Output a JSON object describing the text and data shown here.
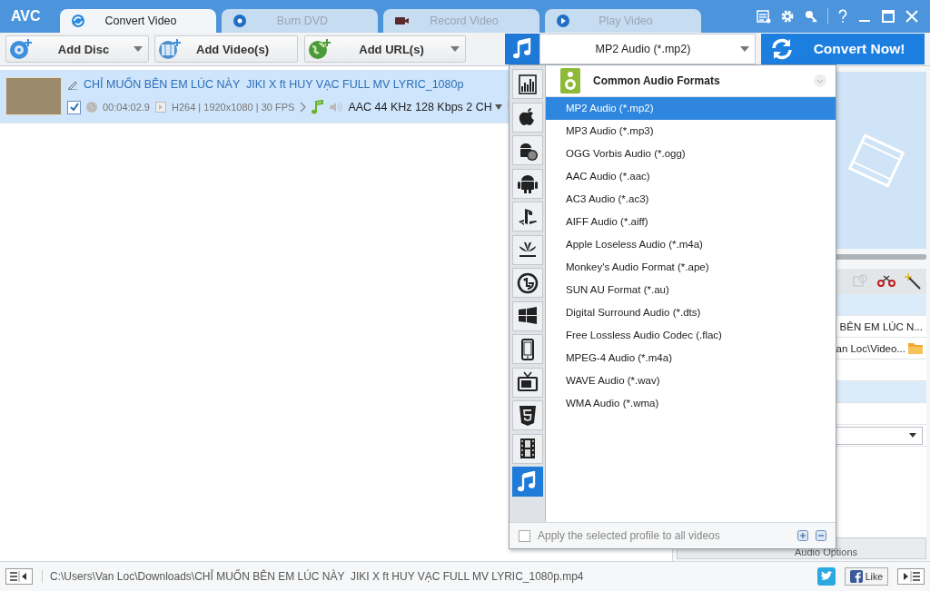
{
  "app": {
    "logo": "AVC"
  },
  "tabs": [
    {
      "label": "Convert Video",
      "kind": "convert",
      "selected": true
    },
    {
      "label": "Burn DVD",
      "kind": "dvd",
      "selected": false
    },
    {
      "label": "Record Video",
      "kind": "record",
      "selected": false
    },
    {
      "label": "Play Video",
      "kind": "play",
      "selected": false
    }
  ],
  "toolbar": {
    "buttons": [
      {
        "label": "Add Disc",
        "kind": "disc",
        "dropdown": true
      },
      {
        "label": "Add Video(s)",
        "kind": "video",
        "dropdown": false
      },
      {
        "label": "Add URL(s)",
        "kind": "url",
        "dropdown": true
      }
    ],
    "profile": "MP2 Audio (*.mp2)",
    "convert": "Convert Now!"
  },
  "files": [
    {
      "title": "CHỈ MUỐN BÊN EM LÚC NÀY  JIKI X ft HUY VẠC FULL MV LYRIC_1080p",
      "checked": true,
      "selected": true,
      "duration": "00:04:02.9",
      "video": "H264 | 1920x1080 | 30 FPS",
      "audio": "AAC 44 KHz 128 Kbps 2 CH"
    }
  ],
  "side_panel": {
    "file_name": "BÊN EM LÚC N...",
    "output_folder": "an Loc\\Video...",
    "audio_options": "Audio Options"
  },
  "profile_menu": {
    "categories": [
      {
        "kind": "all",
        "selected": false
      },
      {
        "kind": "apple",
        "selected": false
      },
      {
        "kind": "android-s",
        "selected": false
      },
      {
        "kind": "android",
        "selected": false
      },
      {
        "kind": "playstation",
        "selected": false
      },
      {
        "kind": "huawei",
        "selected": false
      },
      {
        "kind": "lg",
        "selected": false
      },
      {
        "kind": "windows",
        "selected": false
      },
      {
        "kind": "phone",
        "selected": false
      },
      {
        "kind": "tv",
        "selected": false
      },
      {
        "kind": "html5",
        "selected": false
      },
      {
        "kind": "film",
        "selected": false
      },
      {
        "kind": "music",
        "selected": true
      }
    ],
    "group": "Common Audio Formats",
    "formats": [
      {
        "label": "MP2 Audio (*.mp2)",
        "selected": true
      },
      {
        "label": "MP3 Audio (*.mp3)",
        "selected": false
      },
      {
        "label": "OGG Vorbis Audio (*.ogg)",
        "selected": false
      },
      {
        "label": "AAC Audio (*.aac)",
        "selected": false
      },
      {
        "label": "AC3 Audio (*.ac3)",
        "selected": false
      },
      {
        "label": "AIFF Audio (*.aiff)",
        "selected": false
      },
      {
        "label": "Apple Loseless Audio (*.m4a)",
        "selected": false
      },
      {
        "label": "Monkey's Audio Format (*.ape)",
        "selected": false
      },
      {
        "label": "SUN AU Format (*.au)",
        "selected": false
      },
      {
        "label": "Digital Surround Audio (*.dts)",
        "selected": false
      },
      {
        "label": "Free Lossless Audio Codec (.flac)",
        "selected": false
      },
      {
        "label": "MPEG-4 Audio (*.m4a)",
        "selected": false
      },
      {
        "label": "WAVE Audio (*.wav)",
        "selected": false
      },
      {
        "label": "WMA Audio (*.wma)",
        "selected": false
      }
    ],
    "apply_all": {
      "label": "Apply the selected profile to all videos",
      "checked": false
    }
  },
  "status_bar": {
    "path": "C:\\Users\\Van Loc\\Downloads\\CHỈ MUỐN BÊN EM LÚC NÀY  JIKI X ft HUY VẠC FULL MV LYRIC_1080p.mp4",
    "like": "Like"
  }
}
